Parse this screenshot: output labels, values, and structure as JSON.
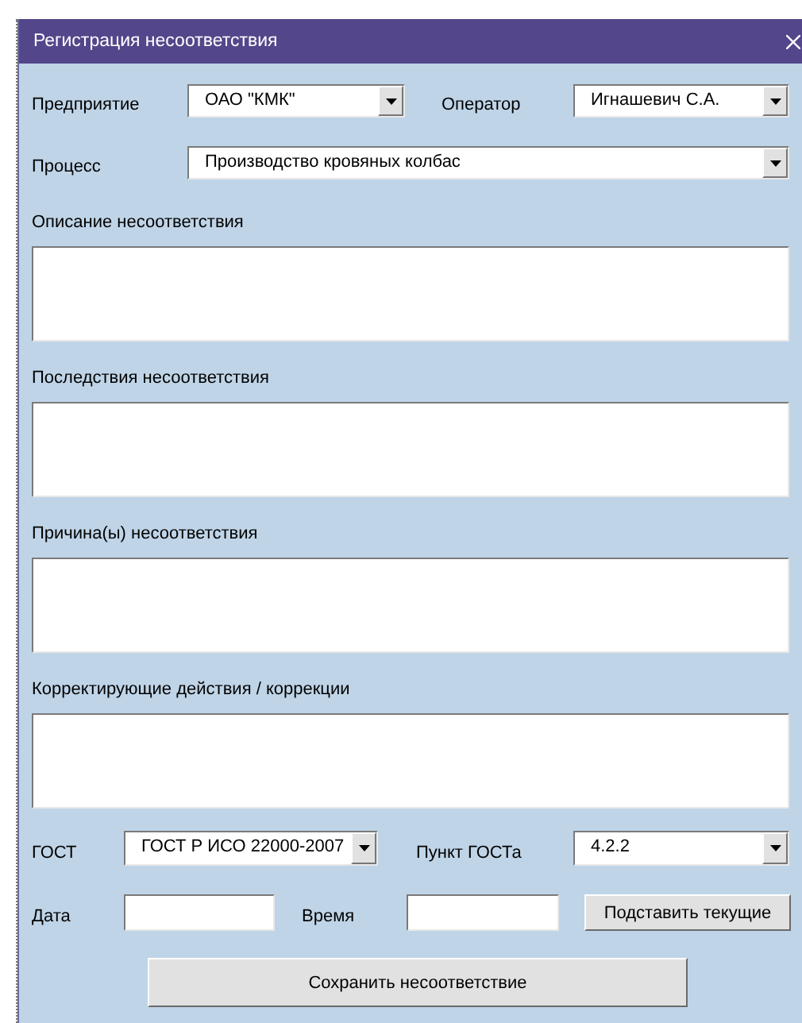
{
  "window": {
    "title": "Регистрация несоответствия"
  },
  "enterprise": {
    "label": "Предприятие",
    "value": "ОАО \"КМК\""
  },
  "operator": {
    "label": "Оператор",
    "value": "Игнашевич С.А."
  },
  "process": {
    "label": "Процесс",
    "value": "Производство кровяных колбас"
  },
  "sections": [
    {
      "label": "Описание несоответствия"
    },
    {
      "label": "Последствия несоответствия"
    },
    {
      "label": "Причина(ы) несоответствия"
    },
    {
      "label": "Корректирующие действия / коррекции"
    }
  ],
  "gost": {
    "label": "ГОСТ",
    "value": "ГОСТ Р ИСО 22000-2007"
  },
  "clause": {
    "label": "Пункт ГОСТа",
    "value": "4.2.2"
  },
  "date": {
    "label": "Дата"
  },
  "time": {
    "label": "Время"
  },
  "fill_button": "Подставить текущие",
  "save_button": "Сохранить несоответствие"
}
